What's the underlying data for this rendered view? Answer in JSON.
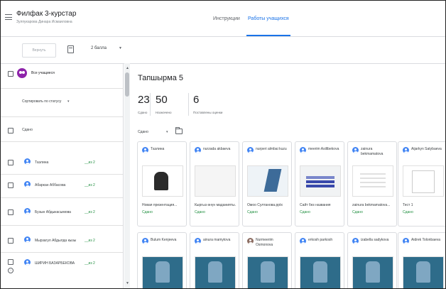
{
  "header": {
    "course_title": "Филфак 3-курстар",
    "teacher": "Зулпукарова Динара Исмаиловна",
    "tabs": [
      {
        "label": "Инструкции",
        "active": false
      },
      {
        "label": "Работы учащихся",
        "active": true
      }
    ],
    "accent_color": "#1a73e8"
  },
  "toolbar": {
    "return_label": "Вернуть",
    "points_value": "2 балла"
  },
  "left_panel": {
    "all_students_label": "Все учащиеся",
    "sort_label": "Сортировать по статусу",
    "section_label": "Сдано",
    "students": [
      {
        "name": "Таэлина",
        "grade": "__из 2"
      },
      {
        "name": "Абаркан Аббасова",
        "grade": "__из 2"
      },
      {
        "name": "Бузын Абдыкасымова",
        "grade": "__из 2"
      },
      {
        "name": "Мырзагул Абдылда кызы",
        "grade": "__из 2"
      },
      {
        "name": "ШИРИН БАЗАРБЕКОВА",
        "grade": "__из 2"
      }
    ]
  },
  "main": {
    "assignment_title": "Тапшырма 5",
    "stats": [
      {
        "value": "23",
        "label": "Сдано"
      },
      {
        "value": "50",
        "label": "Назначено"
      },
      {
        "value": "6",
        "label": "Поставлены оценки"
      }
    ],
    "filter_label": "Сдано",
    "cards": [
      {
        "name": "Таэлина",
        "doc": "Новая презентация...",
        "status": "Сдано"
      },
      {
        "name": "nurzada akbaeva",
        "doc": "Кыргыз өнүн маданияты...",
        "status": "Сдано"
      },
      {
        "name": "nurperi almbai kuzu",
        "doc": "Омоо Султанова.pptx",
        "status": "Сдано"
      },
      {
        "name": "meerim Asiltbekova",
        "doc": "Сайт без названия",
        "status": "Сдано"
      },
      {
        "name": "zainura bekmamatova",
        "doc": "zainura bekmamatova...",
        "status": "Сдано"
      },
      {
        "name": "Aijarkyn Satybaeva",
        "doc": "Тест 1",
        "status": "Сдано"
      }
    ],
    "cards_row2": [
      {
        "name": "Bulum Kenjeeva"
      },
      {
        "name": "ainura mamytova"
      },
      {
        "name": "Nurmeerim Osmonova"
      },
      {
        "name": "erkosh parkosh"
      },
      {
        "name": "izabella sadykova"
      },
      {
        "name": "Aidrek Tolonbaeva"
      }
    ]
  }
}
